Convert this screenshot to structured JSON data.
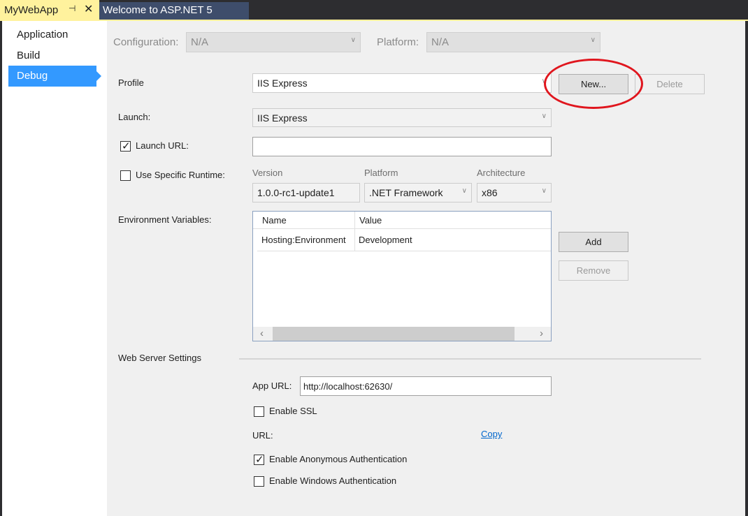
{
  "tabs": {
    "active": "MyWebApp",
    "pin_glyph": "⊣",
    "close_glyph": "✕",
    "second": "Welcome to ASP.NET 5"
  },
  "sidebar": {
    "items": [
      {
        "label": "Application"
      },
      {
        "label": "Build"
      },
      {
        "label": "Debug",
        "active": true
      }
    ]
  },
  "top": {
    "configuration_label": "Configuration:",
    "configuration_value": "N/A",
    "platform_label": "Platform:",
    "platform_value": "N/A"
  },
  "profile": {
    "label": "Profile",
    "value": "IIS Express",
    "new_label": "New...",
    "delete_label": "Delete"
  },
  "launch": {
    "label": "Launch:",
    "value": "IIS Express",
    "launch_url_label": "Launch URL:",
    "launch_url_checked": true,
    "launch_url_value": ""
  },
  "runtime": {
    "label": "Use Specific Runtime:",
    "checked": false,
    "version_label": "Version",
    "version_value": "1.0.0-rc1-update1",
    "platform_label": "Platform",
    "platform_value": ".NET Framework",
    "arch_label": "Architecture",
    "arch_value": "x86"
  },
  "env": {
    "label": "Environment Variables:",
    "col_name": "Name",
    "col_value": "Value",
    "rows": [
      {
        "name": "Hosting:Environment",
        "value": "Development"
      }
    ],
    "add_label": "Add",
    "remove_label": "Remove"
  },
  "web": {
    "section_label": "Web Server Settings",
    "app_url_label": "App URL:",
    "app_url_value": "http://localhost:62630/",
    "ssl_label": "Enable SSL",
    "ssl_checked": false,
    "url_label": "URL:",
    "copy_label": "Copy",
    "anon_label": "Enable Anonymous Authentication",
    "anon_checked": true,
    "win_label": "Enable Windows Authentication",
    "win_checked": false
  },
  "icons": {
    "dropdown": "chevron-down-icon",
    "check": "✓",
    "scroll_left": "‹",
    "scroll_right": "›"
  },
  "colors": {
    "accent": "#3399ff",
    "active_tab": "#fff29d",
    "highlight_circle": "#e0161e"
  }
}
